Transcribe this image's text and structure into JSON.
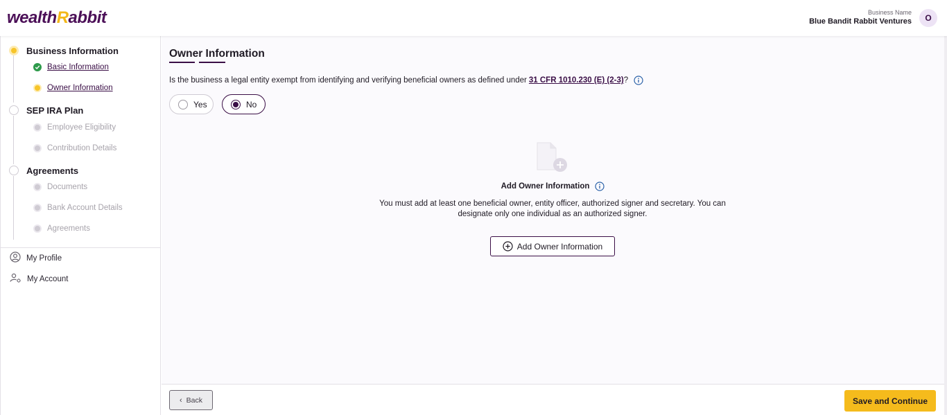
{
  "header": {
    "logo_main": "wealth",
    "logo_accent": "R",
    "logo_end": "abbit",
    "business_label": "Business Name",
    "business_name": "Blue Bandit Rabbit Ventures",
    "avatar_initial": "O"
  },
  "sidebar": {
    "steps": [
      {
        "label": "Business Information",
        "state": "active",
        "items": [
          {
            "label": "Basic Information",
            "state": "done"
          },
          {
            "label": "Owner Information",
            "state": "current"
          }
        ]
      },
      {
        "label": "SEP IRA Plan",
        "state": "todo",
        "items": [
          {
            "label": "Employee Eligibility",
            "state": "todo"
          },
          {
            "label": "Contribution Details",
            "state": "todo"
          }
        ]
      },
      {
        "label": "Agreements",
        "state": "todo",
        "items": [
          {
            "label": "Documents",
            "state": "todo"
          },
          {
            "label": "Bank Account Details",
            "state": "todo"
          },
          {
            "label": "Agreements",
            "state": "todo"
          }
        ]
      }
    ],
    "menu": [
      {
        "label": "My Profile",
        "icon": "user-circle-icon"
      },
      {
        "label": "My Account",
        "icon": "user-gear-icon"
      }
    ]
  },
  "main": {
    "title": "Owner Information",
    "question_text": "Is the business a legal entity exempt from identifying and verifying beneficial owners as defined under",
    "question_link": "31 CFR 1010.230 (E) (2-3)",
    "question_end": "?",
    "options": [
      {
        "label": "Yes",
        "selected": false
      },
      {
        "label": "No",
        "selected": true
      }
    ],
    "empty_title": "Add Owner Information",
    "empty_desc": "You must add at least one beneficial owner, entity officer, authorized signer and secretary. You can designate only one individual as an authorized signer.",
    "add_button": "Add Owner Information"
  },
  "footer": {
    "back_label": "Back",
    "save_label": "Save and Continue"
  },
  "colors": {
    "brand_purple": "#3a0e46",
    "brand_yellow": "#f5bb1c",
    "success_green": "#2e9a4b"
  }
}
